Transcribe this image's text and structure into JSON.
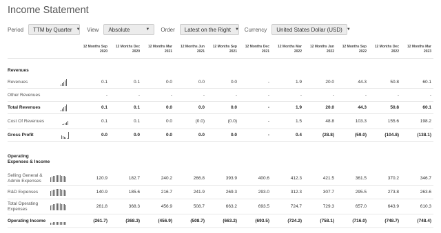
{
  "title": "Income Statement",
  "controls": {
    "period_label": "Period",
    "period_value": "TTM by Quarter",
    "view_label": "View",
    "view_value": "Absolute",
    "order_label": "Order",
    "order_value": "Latest on the Right",
    "currency_label": "Currency",
    "currency_value": "United States Dollar (USD)"
  },
  "columns": [
    [
      "12 Months Sep",
      "2020"
    ],
    [
      "12 Months Dec",
      "2020"
    ],
    [
      "12 Months Mar",
      "2021"
    ],
    [
      "12 Months Jun",
      "2021"
    ],
    [
      "12 Months Sep",
      "2021"
    ],
    [
      "12 Months Dec",
      "2021"
    ],
    [
      "12 Months Mar",
      "2022"
    ],
    [
      "12 Months Jun",
      "2022"
    ],
    [
      "12 Months Sep",
      "2022"
    ],
    [
      "12 Months Dec",
      "2022"
    ],
    [
      "12 Months Mar",
      "2023"
    ]
  ],
  "rows": [
    {
      "label": "Revenues",
      "type": "section"
    },
    {
      "label": "Revenues",
      "type": "data",
      "spark": "up",
      "values": [
        "0.1",
        "0.1",
        "0.0",
        "0.0",
        "0.0",
        "-",
        "1.9",
        "20.0",
        "44.3",
        "50.8",
        "60.1"
      ]
    },
    {
      "label": "Other Revenues",
      "type": "data",
      "values": [
        "-",
        "-",
        "-",
        "-",
        "-",
        "-",
        "-",
        "-",
        "-",
        "-",
        "-"
      ]
    },
    {
      "label": "Total Revenues",
      "type": "total",
      "spark": "up",
      "values": [
        "0.1",
        "0.1",
        "0.0",
        "0.0",
        "0.0",
        "-",
        "1.9",
        "20.0",
        "44.3",
        "50.8",
        "60.1"
      ]
    },
    {
      "label": "Cost Of Revenues",
      "type": "data",
      "spark": "up-small",
      "values": [
        "0.1",
        "0.1",
        "0.0",
        "(0.0)",
        "(0.0)",
        "-",
        "1.5",
        "48.8",
        "103.3",
        "155.6",
        "198.2"
      ]
    },
    {
      "label": "Gross Profit",
      "type": "total",
      "spark": "down",
      "values": [
        "0.0",
        "0.0",
        "0.0",
        "0.0",
        "0.0",
        "-",
        "0.4",
        "(28.8)",
        "(59.0)",
        "(104.8)",
        "(138.1)"
      ]
    },
    {
      "label": "Operating Expenses & Income",
      "type": "section"
    },
    {
      "label": "Selling General & Admin Expenses",
      "type": "data",
      "spark": "full",
      "values": [
        "120.9",
        "182.7",
        "240.2",
        "266.8",
        "393.9",
        "400.6",
        "412.3",
        "421.5",
        "361.5",
        "370.2",
        "346.7"
      ]
    },
    {
      "label": "R&D Expenses",
      "type": "data",
      "spark": "full",
      "values": [
        "140.9",
        "185.6",
        "216.7",
        "241.9",
        "269.3",
        "293.0",
        "312.3",
        "307.7",
        "295.5",
        "273.8",
        "263.6"
      ]
    },
    {
      "label": "Total Operating Expenses",
      "type": "data",
      "spark": "full",
      "values": [
        "261.8",
        "368.3",
        "456.9",
        "508.7",
        "663.2",
        "693.5",
        "724.7",
        "729.3",
        "657.0",
        "643.9",
        "610.3"
      ]
    },
    {
      "label": "Operating Income",
      "type": "total",
      "spark": "neg",
      "values": [
        "(261.7)",
        "(368.3)",
        "(456.9)",
        "(508.7)",
        "(663.2)",
        "(693.5)",
        "(724.2)",
        "(758.1)",
        "(716.0)",
        "(748.7)",
        "(748.4)"
      ]
    }
  ]
}
